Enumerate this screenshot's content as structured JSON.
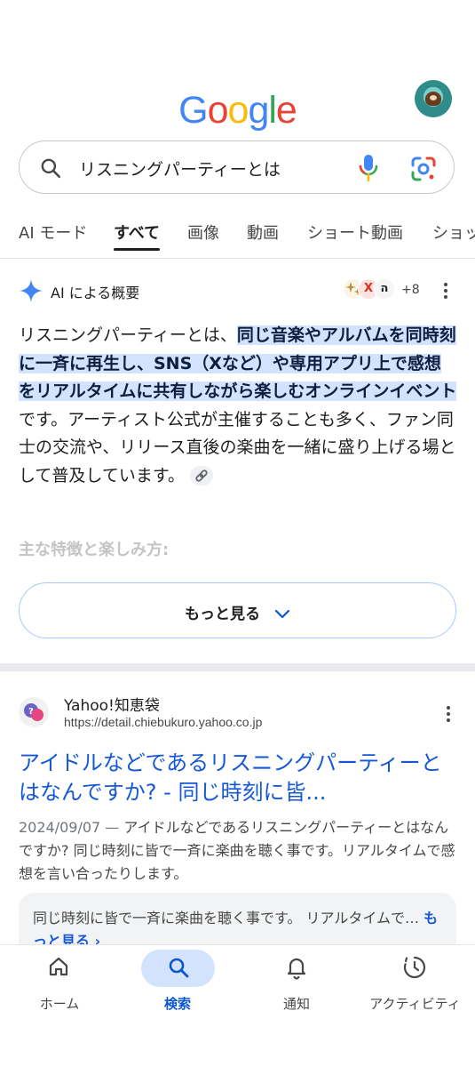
{
  "header": {
    "logo_letters": [
      {
        "char": "G",
        "color": "#4285F4"
      },
      {
        "char": "o",
        "color": "#EA4335"
      },
      {
        "char": "o",
        "color": "#FBBC05"
      },
      {
        "char": "g",
        "color": "#4285F4"
      },
      {
        "char": "l",
        "color": "#34A853"
      },
      {
        "char": "e",
        "color": "#EA4335"
      }
    ]
  },
  "search": {
    "query": "リスニングパーティーとは"
  },
  "tabs": [
    {
      "label": "AI モード"
    },
    {
      "label": "すべて",
      "active": true
    },
    {
      "label": "画像"
    },
    {
      "label": "動画"
    },
    {
      "label": "ショート動画"
    },
    {
      "label": "ショッ"
    }
  ],
  "ai_overview": {
    "title": "AI による概要",
    "source_more": "+8",
    "source_letter_1": "X",
    "source_letter_2": "ה",
    "body_prefix": "リスニングパーティーとは、",
    "body_highlight": "同じ音楽やアルバムを同時刻に一斉に再生し、SNS（Xなど）や専用アプリ上で感想をリアルタイムに共有しながら楽しむオンラインイベント",
    "body_suffix": "です。アーティスト公式が主催することも多く、ファン同士の交流や、リリース直後の楽曲を一緒に盛り上げる場として普及しています。",
    "subheading": "主な特徴と楽しみ方:",
    "more_button": "もっと見る"
  },
  "result": {
    "site_name": "Yahoo!知恵袋",
    "url": "https://detail.chiebukuro.yahoo.co.jp",
    "title": "アイドルなどであるリスニングパーティーとはなんですか? - 同じ時刻に皆...",
    "date": "2024/09/07 —",
    "snippet": " アイドルなどであるリスニングパーティーとはなんですか? 同じ時刻に皆で一斉に楽曲を聴く事です。リアルタイムで感想を言い合ったりします。",
    "featured_text": "同じ時刻に皆で一斉に楽曲を聴く事です。 リアルタイムで…",
    "featured_more": "もっと見る ›"
  },
  "bottom_nav": [
    {
      "label": "ホーム",
      "icon": "home-icon"
    },
    {
      "label": "検索",
      "icon": "search-icon",
      "active": true
    },
    {
      "label": "通知",
      "icon": "bell-icon"
    },
    {
      "label": "アクティビティ",
      "icon": "activity-icon"
    }
  ],
  "colors": {
    "link_blue": "#1558d6",
    "highlight": "#d3e3fd",
    "nav_active": "#0b57d0",
    "gemini_blue": "#4285F4"
  }
}
